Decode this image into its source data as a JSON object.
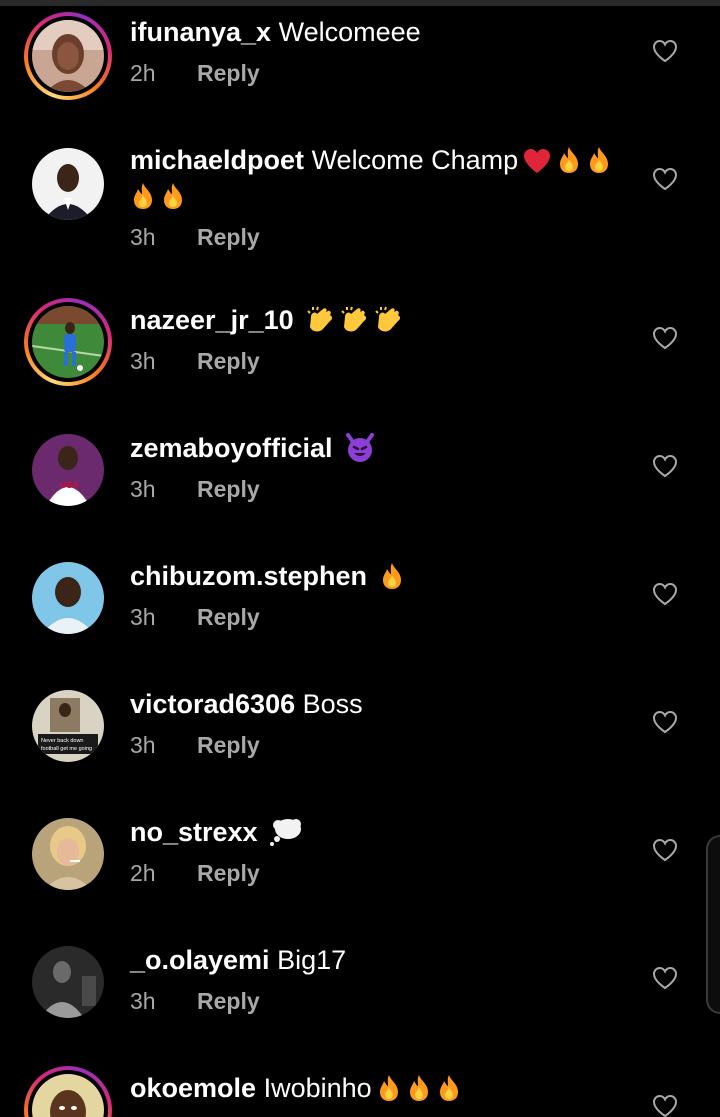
{
  "comments": [
    {
      "username": "ifunanya_x",
      "text": "Welcomeee",
      "emojis": [],
      "time": "2h",
      "reply": "Reply",
      "story_ring": true,
      "avatar": "woman-portrait"
    },
    {
      "username": "michaeldpoet",
      "text": "Welcome Champ",
      "emojis": [
        "heart",
        "fire",
        "fire",
        "fire",
        "fire"
      ],
      "time": "3h",
      "reply": "Reply",
      "story_ring": false,
      "avatar": "man-suit"
    },
    {
      "username": "nazeer_jr_10",
      "text": "",
      "emojis": [
        "clap",
        "clap",
        "clap"
      ],
      "time": "3h",
      "reply": "Reply",
      "story_ring": true,
      "avatar": "football-pitch"
    },
    {
      "username": "zemaboyofficial",
      "text": "",
      "emojis": [
        "smiling-devil"
      ],
      "time": "3h",
      "reply": "Reply",
      "story_ring": false,
      "avatar": "usa-shirt"
    },
    {
      "username": "chibuzom.stephen",
      "text": "",
      "emojis": [
        "fire"
      ],
      "time": "3h",
      "reply": "Reply",
      "story_ring": false,
      "avatar": "man-sky"
    },
    {
      "username": "victorad6306",
      "text": "Boss",
      "emojis": [],
      "time": "3h",
      "reply": "Reply",
      "story_ring": false,
      "avatar": "text-poster",
      "avatar_text": [
        "Never back down",
        "football get me going"
      ]
    },
    {
      "username": "no_strexx",
      "text": "",
      "emojis": [
        "thought-balloon"
      ],
      "time": "2h",
      "reply": "Reply",
      "story_ring": false,
      "avatar": "woman-blonde"
    },
    {
      "username": "_o.olayemi",
      "text": "Big17",
      "emojis": [],
      "time": "3h",
      "reply": "Reply",
      "story_ring": false,
      "avatar": "bw-man"
    },
    {
      "username": "okoemole",
      "text": "Iwobinho",
      "emojis": [
        "fire",
        "fire",
        "fire"
      ],
      "time": "",
      "reply": "",
      "story_ring": true,
      "avatar": "man-face"
    }
  ],
  "icons": {
    "like": "heart-outline-icon"
  },
  "colors": {
    "background": "#000000",
    "meta_text": "#a8a8a8",
    "fire": "#ff9a1f",
    "heart": "#e0243a",
    "devil": "#8b3fd6",
    "clap": "#ffc83d"
  }
}
